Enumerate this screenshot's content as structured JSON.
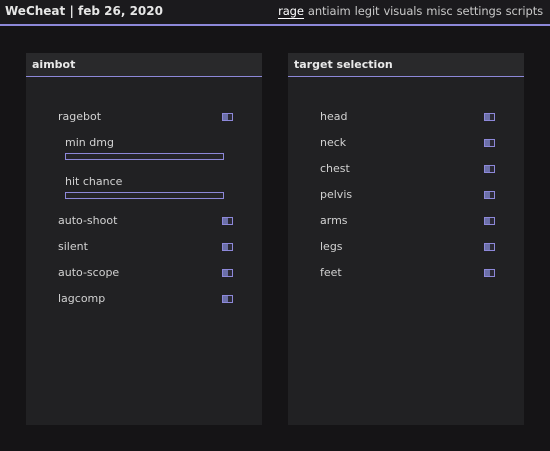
{
  "header": {
    "title": "WeCheat | feb 26, 2020",
    "tabs": [
      {
        "label": "rage",
        "active": true
      },
      {
        "label": "antiaim",
        "active": false
      },
      {
        "label": "legit",
        "active": false
      },
      {
        "label": "visuals",
        "active": false
      },
      {
        "label": "misc",
        "active": false
      },
      {
        "label": "settings",
        "active": false
      },
      {
        "label": "scripts",
        "active": false
      }
    ]
  },
  "colors": {
    "accent": "#8d88d9",
    "background": "#151416",
    "panel": "#212123"
  },
  "aimbot": {
    "title": "aimbot",
    "ragebot": "ragebot",
    "min_dmg": "min dmg",
    "hit_chance": "hit chance",
    "auto_shoot": "auto-shoot",
    "silent": "silent",
    "auto_scope": "auto-scope",
    "lagcomp": "lagcomp"
  },
  "target_selection": {
    "title": "target selection",
    "items": [
      "head",
      "neck",
      "chest",
      "pelvis",
      "arms",
      "legs",
      "feet"
    ]
  }
}
